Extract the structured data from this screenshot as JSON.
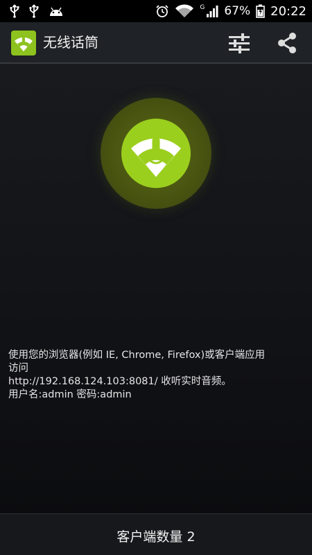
{
  "status_bar": {
    "left_icons": [
      "usb-icon",
      "usb-icon",
      "android-icon"
    ],
    "right_icons": [
      "alarm-icon",
      "wifi-icon",
      "signal-icon",
      "battery-icon"
    ],
    "network_type": "G",
    "battery": "67%",
    "time": "20:22"
  },
  "action_bar": {
    "app_icon": "wifi-mic-icon",
    "title": "无线话筒",
    "actions": [
      "settings-sliders-icon",
      "share-icon"
    ]
  },
  "main": {
    "mic_icon": "wifi-mic-icon",
    "info_lines": [
      "使用您的浏览器(例如 IE, Chrome, Firefox)或客户端应用",
      "访问",
      "http://192.168.124.103:8081/ 收听实时音频。",
      "用户名:admin 密码:admin"
    ]
  },
  "footer": {
    "client_count": "客户端数量 2"
  },
  "colors": {
    "accent_green": "#9bcf1e",
    "ring_green": "#485310",
    "app_icon_green": "#8dc21f"
  }
}
